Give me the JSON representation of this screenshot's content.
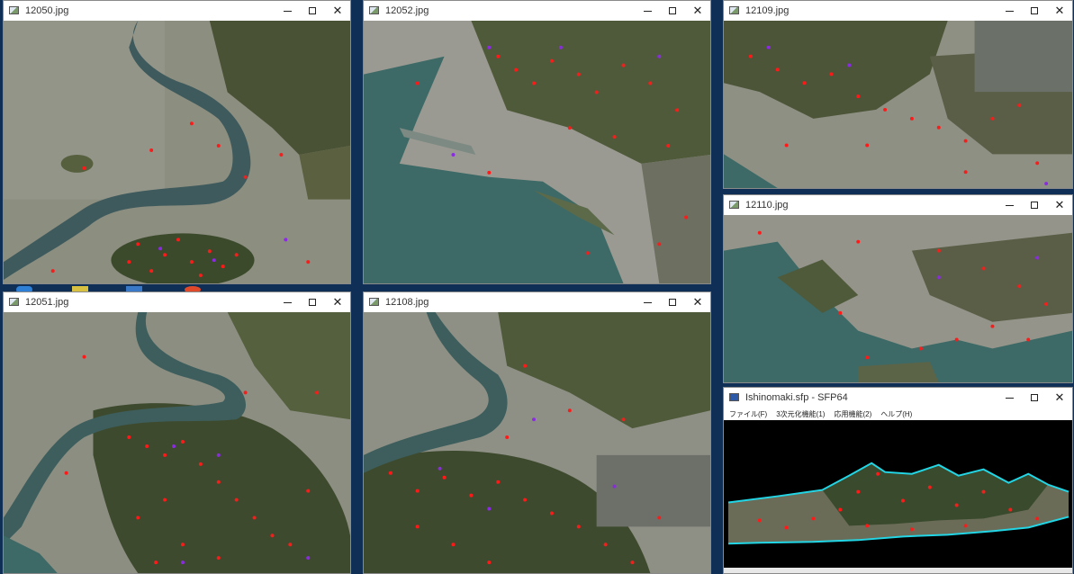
{
  "windows": [
    {
      "id": "w12050",
      "title": "12050.jpg"
    },
    {
      "id": "w12052",
      "title": "12052.jpg"
    },
    {
      "id": "w12109",
      "title": "12109.jpg"
    },
    {
      "id": "w12110",
      "title": "12110.jpg"
    },
    {
      "id": "w12051",
      "title": "12051.jpg"
    },
    {
      "id": "w12108",
      "title": "12108.jpg"
    }
  ],
  "sfp_window": {
    "title": "Ishinomaki.sfp - SFP64",
    "menu": [
      "ファイル(F)",
      "3次元化機能(1)",
      "応用機能(2)",
      "ヘルプ(H)"
    ]
  },
  "colors": {
    "desktop": "#0f2f57",
    "marker_red": "#ff1a1a",
    "marker_purple": "#8a2be2",
    "terrain_edge": "#22d6e6"
  },
  "icons": {
    "minimize": "minimize-icon",
    "maximize": "maximize-icon",
    "close": "close-icon",
    "app": "image-file-icon"
  },
  "glyphs": {
    "close": "✕"
  }
}
